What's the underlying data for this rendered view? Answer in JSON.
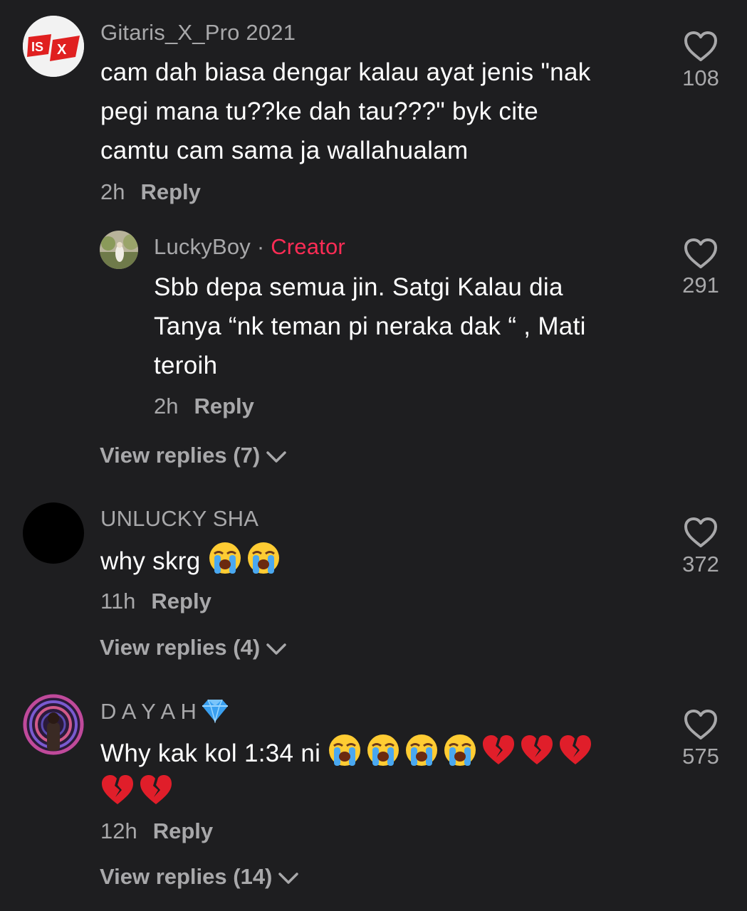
{
  "comments": [
    {
      "username": "Gitaris_X_Pro 2021",
      "text_lines": [
        "cam dah biasa dengar kalau ayat jenis \"nak",
        "pegi mana tu??ke dah tau???\" byk cite",
        "camtu cam sama ja wallahualam"
      ],
      "time": "2h",
      "reply_label": "Reply",
      "likes": "108",
      "reply": {
        "username": "LuckyBoy",
        "separator": "·",
        "badge": "Creator",
        "text_lines": [
          "Sbb depa semua jin. Satgi Kalau dia",
          "Tanya “nk teman pi neraka dak “ , Mati",
          "teroih"
        ],
        "time": "2h",
        "reply_label": "Reply",
        "likes": "291"
      },
      "view_replies": "View replies (7)"
    },
    {
      "username": "UNLUCKY SHA",
      "text": "why skrg",
      "emojis": [
        "loudly-crying-face",
        "loudly-crying-face"
      ],
      "time": "11h",
      "reply_label": "Reply",
      "likes": "372",
      "view_replies": "View replies (4)"
    },
    {
      "username": "D A Y A H",
      "username_emoji": "gem-stone",
      "text": "Why kak kol 1:34 ni",
      "emojis_line1": [
        "loudly-crying-face",
        "loudly-crying-face",
        "loudly-crying-face",
        "loudly-crying-face",
        "broken-heart",
        "broken-heart",
        "broken-heart"
      ],
      "emojis_line2": [
        "broken-heart",
        "broken-heart"
      ],
      "time": "12h",
      "reply_label": "Reply",
      "likes": "575",
      "view_replies": "View replies (14)"
    }
  ],
  "colors": {
    "background": "#1e1e20",
    "secondary_text": "#a8a8aa",
    "creator_badge": "#fe2c55",
    "primary_text": "#ffffff"
  }
}
